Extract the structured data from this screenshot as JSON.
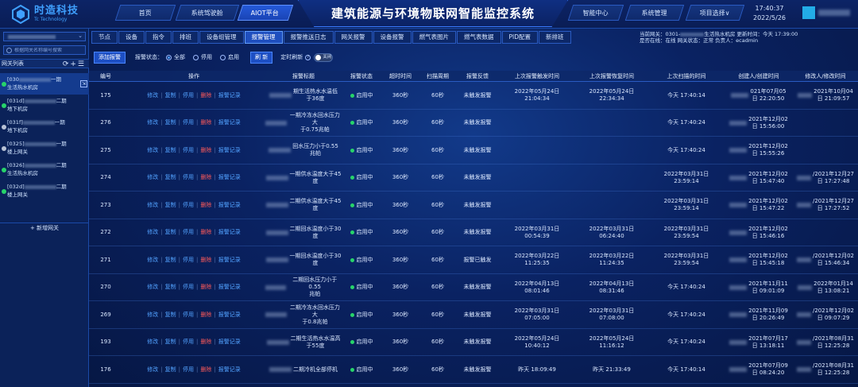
{
  "header": {
    "logo_cn": "时造科技",
    "logo_en": "Tc Technology",
    "nav_left": [
      "首页",
      "系统驾驶舱",
      "AIOT平台"
    ],
    "title": "建筑能源与环境物联网智能监控系统",
    "nav_right": [
      "智能中心",
      "系统管理",
      "项目选择"
    ],
    "time": "17:40:37",
    "date": "2022/5/26"
  },
  "sidebar": {
    "search_placeholder": "根据网关名称编号搜索",
    "list_title": "网关列表",
    "items": [
      {
        "code": "[030",
        "text1": "一期",
        "text2": "生活热水机房",
        "status": "green",
        "selected": true
      },
      {
        "code": "[031d]",
        "text1": "二期",
        "text2": "地下机房",
        "status": "green",
        "selected": false
      },
      {
        "code": "[031f]",
        "text1": "一期",
        "text2": "地下机房",
        "status": "gray",
        "selected": false
      },
      {
        "code": "[0325]",
        "text1": "一期",
        "text2": "楼上网关",
        "status": "gray",
        "selected": false
      },
      {
        "code": "[0326]",
        "text1": "二期",
        "text2": "生活热水机房",
        "status": "green",
        "selected": false
      },
      {
        "code": "[032d]",
        "text1": "二期",
        "text2": "楼上网关",
        "status": "green",
        "selected": false
      }
    ],
    "add_label": "新增网关"
  },
  "tabs": [
    "节点",
    "设备",
    "指令",
    "排班",
    "设备组管理",
    "报警管理",
    "报警推送日志",
    "网关报警",
    "设备报警",
    "燃气表图片",
    "燃气表数据",
    "PID配置",
    "新排班"
  ],
  "active_tab": 5,
  "gateway_status": {
    "line1_prefix": "当前网关：0301-",
    "line1_mid": "生活热水机房",
    "line1_update": "更新时间：今天 17:39:00",
    "line2": "是否在线：在线   网关状态：正常   负责人：ecadmin"
  },
  "toolbar": {
    "add_button": "添加报警",
    "status_label": "报警状态：",
    "radio_all": "全部",
    "radio_disabled": "停用",
    "radio_enabled": "启用",
    "refresh_button": "刷 新",
    "auto_refresh_label": "定时刷新",
    "toggle_label": "关闭"
  },
  "table": {
    "headers": [
      "编号",
      "操作",
      "报警标题",
      "报警状态",
      "超时时间",
      "扫描周期",
      "报警反馈",
      "上次报警触发时间",
      "上次报警恢复时间",
      "上次扫描的时间",
      "创建人/创建时间",
      "修改人/修改时间"
    ],
    "op_labels": [
      "修改",
      "复制",
      "停用",
      "删除",
      "报警记录"
    ],
    "rows": [
      {
        "id": "175",
        "title": [
          "期生活热水水温低",
          "于36度"
        ],
        "status": "启用中",
        "timeout": "360秒",
        "scan": "60秒",
        "feedback": "未触发报警",
        "trigger": [
          "2022年05月24日",
          "21:04:34"
        ],
        "recover": [
          "2022年05月24日",
          "22:34:34"
        ],
        "scan_time": [
          "今天 17:40:14"
        ],
        "created": [
          "021年07月05",
          "日 22:20:50"
        ],
        "modified": [
          "2021年10月04",
          "日 21:09:57"
        ]
      },
      {
        "id": "276",
        "title": [
          "一期冷冻水回水压力大",
          "于0.75兆帕"
        ],
        "status": "启用中",
        "timeout": "360秒",
        "scan": "60秒",
        "feedback": "未触发报警",
        "trigger": [],
        "recover": [],
        "scan_time": [
          "今天 17:40:24"
        ],
        "created": [
          "2021年12月02",
          "日 15:56:00"
        ],
        "modified": []
      },
      {
        "id": "275",
        "title": [
          "回水压力小于0.55",
          "兆帕"
        ],
        "status": "启用中",
        "timeout": "360秒",
        "scan": "60秒",
        "feedback": "未触发报警",
        "trigger": [],
        "recover": [],
        "scan_time": [
          "今天 17:40:24"
        ],
        "created": [
          "2021年12月02",
          "日 15:55:26"
        ],
        "modified": []
      },
      {
        "id": "274",
        "title": [
          "一期供水温度大于45",
          "度"
        ],
        "status": "启用中",
        "timeout": "360秒",
        "scan": "60秒",
        "feedback": "未触发报警",
        "trigger": [],
        "recover": [],
        "scan_time": [
          "2022年03月31日",
          "23:59:14"
        ],
        "created": [
          "2021年12月02",
          "日 15:47:40"
        ],
        "modified": [
          "/2021年12月27",
          "日 17:27:48"
        ]
      },
      {
        "id": "273",
        "title": [
          "二期供水温度大于45",
          "度"
        ],
        "status": "启用中",
        "timeout": "360秒",
        "scan": "60秒",
        "feedback": "未触发报警",
        "trigger": [],
        "recover": [],
        "scan_time": [
          "2022年03月31日",
          "23:59:14"
        ],
        "created": [
          "2021年12月02",
          "日 15:47:22"
        ],
        "modified": [
          "/2021年12月27",
          "日 17:27:52"
        ]
      },
      {
        "id": "272",
        "title": [
          "二期回水温度小于30",
          "度"
        ],
        "status": "启用中",
        "timeout": "360秒",
        "scan": "60秒",
        "feedback": "未触发报警",
        "trigger": [
          "2022年03月31日",
          "00:54:39"
        ],
        "recover": [
          "2022年03月31日",
          "06:24:40"
        ],
        "scan_time": [
          "2022年03月31日",
          "23:59:54"
        ],
        "created": [
          "2021年12月02",
          "日 15:46:16"
        ],
        "modified": []
      },
      {
        "id": "271",
        "title": [
          "一期回水温度小于30",
          "度"
        ],
        "status": "启用中",
        "timeout": "360秒",
        "scan": "60秒",
        "feedback": "报警已触发",
        "trigger": [
          "2022年03月22日",
          "11:25:35"
        ],
        "recover": [
          "2022年03月22日",
          "11:24:35"
        ],
        "scan_time": [
          "2022年03月31日",
          "23:59:54"
        ],
        "created": [
          "2021年12月02",
          "日 15:45:18"
        ],
        "modified": [
          "/2021年12月02",
          "日 15:46:34"
        ]
      },
      {
        "id": "270",
        "title": [
          "二期回水压力小于0.55",
          "兆帕"
        ],
        "status": "启用中",
        "timeout": "360秒",
        "scan": "60秒",
        "feedback": "未触发报警",
        "trigger": [
          "2022年04月13日",
          "08:01:46"
        ],
        "recover": [
          "2022年04月13日",
          "08:31:46"
        ],
        "scan_time": [
          "今天 17:40:24"
        ],
        "created": [
          "2021年11月11",
          "日 09:01:09"
        ],
        "modified": [
          "2022年01月14",
          "日 13:08:21"
        ]
      },
      {
        "id": "269",
        "title": [
          "二期冷冻水回水压力大",
          "于0.8兆帕"
        ],
        "status": "启用中",
        "timeout": "360秒",
        "scan": "60秒",
        "feedback": "未触发报警",
        "trigger": [
          "2022年03月31日",
          "07:05:00"
        ],
        "recover": [
          "2022年03月31日",
          "07:08:00"
        ],
        "scan_time": [
          "今天 17:40:24"
        ],
        "created": [
          "2021年11月09",
          "日 20:26:49"
        ],
        "modified": [
          "/2021年12月02",
          "日 09:07:29"
        ]
      },
      {
        "id": "193",
        "title": [
          "二期生活热水水温高",
          "于55度"
        ],
        "status": "启用中",
        "timeout": "360秒",
        "scan": "60秒",
        "feedback": "未触发报警",
        "trigger": [
          "2022年05月24日",
          "10:40:12"
        ],
        "recover": [
          "2022年05月24日",
          "11:16:12"
        ],
        "scan_time": [
          "今天 17:40:24"
        ],
        "created": [
          "2021年07月17",
          "日 13:18:11"
        ],
        "modified": [
          "/2021年08月31",
          "日 12:25:28"
        ]
      },
      {
        "id": "176",
        "title": [
          "二期冷机全部停机"
        ],
        "status": "启用中",
        "timeout": "360秒",
        "scan": "60秒",
        "feedback": "未触发报警",
        "trigger": [
          "昨天 18:09:49"
        ],
        "recover": [
          "昨天 21:33:49"
        ],
        "scan_time": [
          "今天 17:40:14"
        ],
        "created": [
          "2021年07月09",
          "日 08:24:20"
        ],
        "modified": [
          "/2021年08月31",
          "日 12:25:28"
        ]
      }
    ]
  },
  "colors": {
    "accent": "#1f4fbf",
    "link": "#52a2ff",
    "danger": "#ff5a5a",
    "online": "#27d46a",
    "offline": "#b8c2d6"
  }
}
